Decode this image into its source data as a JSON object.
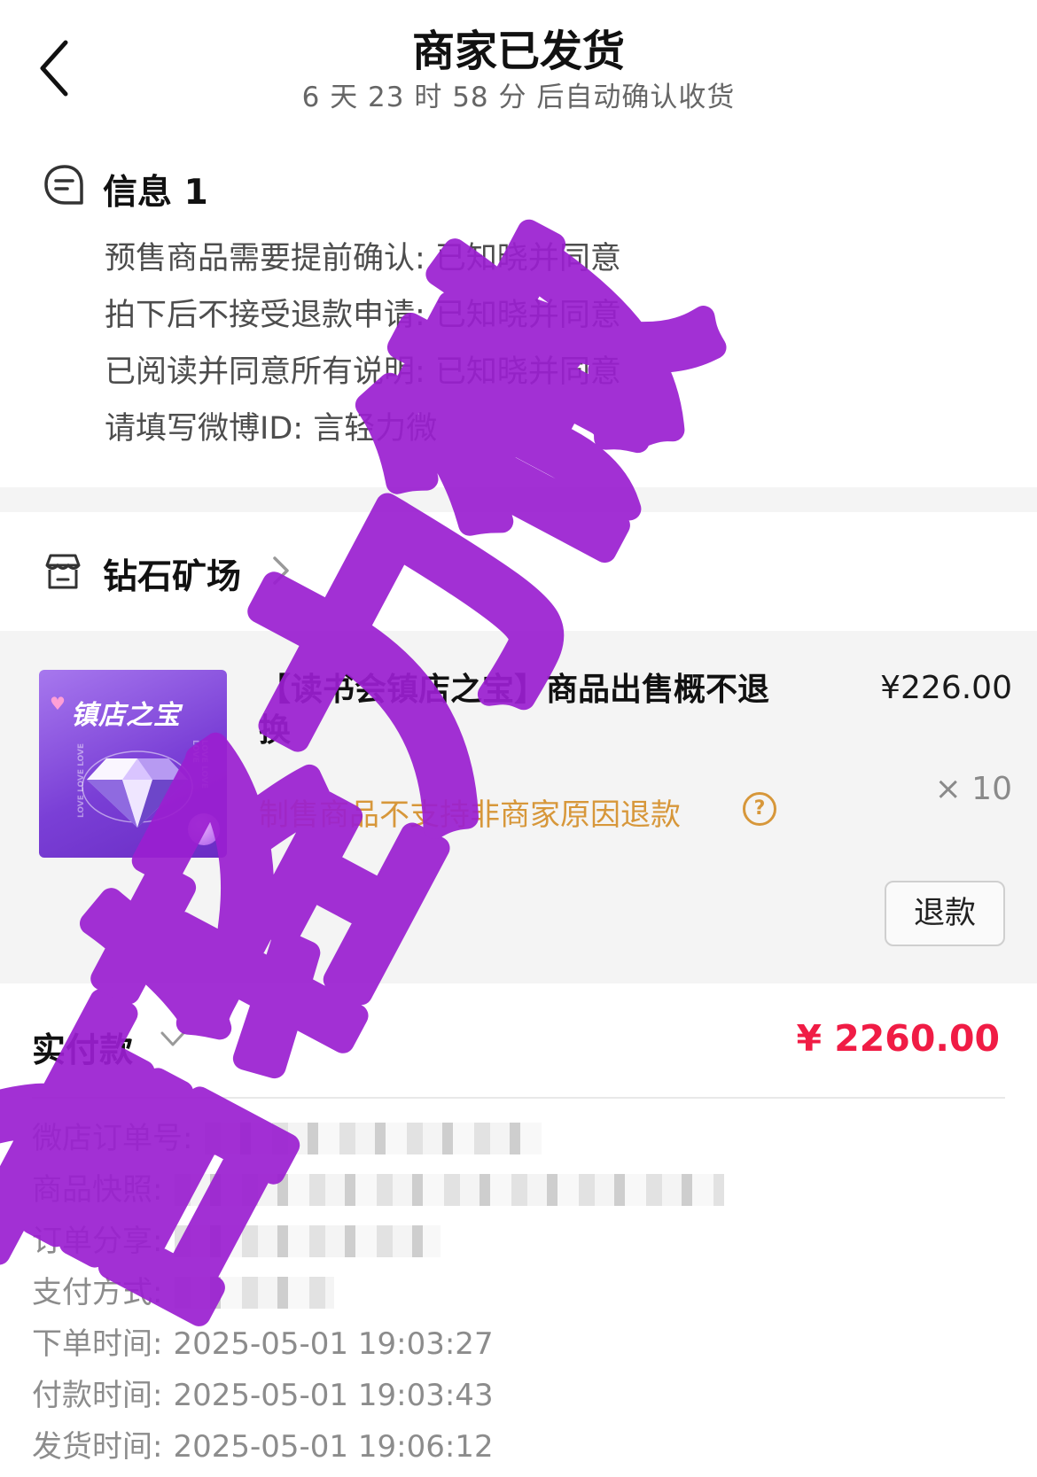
{
  "header": {
    "title": "商家已发货",
    "subtitle": "6 天 23 时 58 分  后自动确认收货"
  },
  "info": {
    "title": "信息 1",
    "items": [
      "预售商品需要提前确认: 已知晓并同意",
      "拍下后不接受退款申请: 已知晓并同意",
      "已阅读并同意所有说明: 已知晓并同意",
      "请填写微博ID: 言轻力微"
    ]
  },
  "shop": {
    "name": "钻石矿场"
  },
  "product": {
    "thumbnail_text": "镇店之宝",
    "title": "【读书会镇店之宝】商品出售概不退换",
    "price": "¥226.00",
    "quantity": "× 10",
    "note": "制售商品不支持非商家原因退款",
    "help_icon": "question-circle-icon",
    "refund_label": "退款"
  },
  "payment": {
    "label": "实付款",
    "amount": "¥ 2260.00",
    "amount_color": "#f01c45"
  },
  "details": [
    {
      "label": "微店订单号:",
      "value": ""
    },
    {
      "label": "商品快照:",
      "value": ""
    },
    {
      "label": "订单分享:",
      "value": ""
    },
    {
      "label": "支付方式:",
      "value": ""
    },
    {
      "label": "下单时间:",
      "value": "2025-05-01 19:03:27"
    },
    {
      "label": "付款时间:",
      "value": "2025-05-01 19:03:43"
    },
    {
      "label": "发货时间:",
      "value": "2025-05-01 19:06:12"
    }
  ],
  "watermark": {
    "text": "言轻力微",
    "color": "#9b1fd1"
  }
}
